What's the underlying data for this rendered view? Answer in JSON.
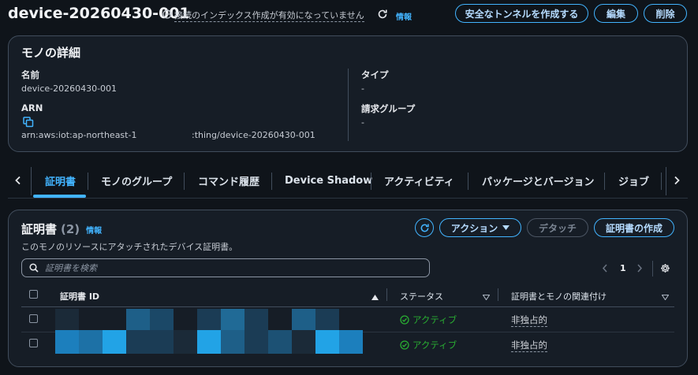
{
  "header": {
    "title": "device-20260430-001",
    "index_status": "接続のインデックス作成が有効になっていません",
    "info_link": "情報",
    "buttons": {
      "tunnel": "安全なトンネルを作成する",
      "edit": "編集",
      "delete": "削除"
    }
  },
  "details": {
    "title": "モノの詳細",
    "name_label": "名前",
    "name_value": "device-20260430-001",
    "arn_label": "ARN",
    "arn_prefix": "arn:aws:iot:ap-northeast-1",
    "arn_suffix": ":thing/device-20260430-001",
    "type_label": "タイプ",
    "type_value": "-",
    "billing_label": "請求グループ",
    "billing_value": "-"
  },
  "tabs": [
    {
      "label": "証明書",
      "active": true
    },
    {
      "label": "モノのグループ"
    },
    {
      "label": "コマンド履歴"
    },
    {
      "label": "Device Shadow"
    },
    {
      "label": "アクティビティ"
    },
    {
      "label": "パッケージとバージョン"
    },
    {
      "label": "ジョブ"
    }
  ],
  "certs": {
    "title": "証明書",
    "count": "(2)",
    "info_link": "情報",
    "description": "このモノのリソースにアタッチされたデバイス証明書。",
    "buttons": {
      "actions": "アクション",
      "detach": "デタッチ",
      "create": "証明書の作成"
    },
    "search_placeholder": "証明書を検索",
    "page": "1",
    "columns": {
      "id": "証明書 ID",
      "status": "ステータス",
      "association": "証明書とモノの関連付け"
    },
    "rows": [
      {
        "status": "アクティブ",
        "association": "非独占的"
      },
      {
        "status": "アクティブ",
        "association": "非独占的"
      }
    ]
  },
  "colors": {
    "accent": "#42b4ff",
    "active_status": "#29ad32",
    "background": "#0f141a",
    "card": "#161d26"
  },
  "icons": [
    "circle-minus-icon",
    "refresh-icon",
    "copy-icon",
    "chevron-left-icon",
    "chevron-right-icon",
    "caret-down-icon",
    "search-icon",
    "gear-icon",
    "sort-up-icon",
    "sort-down-icon",
    "check-circle-icon"
  ]
}
